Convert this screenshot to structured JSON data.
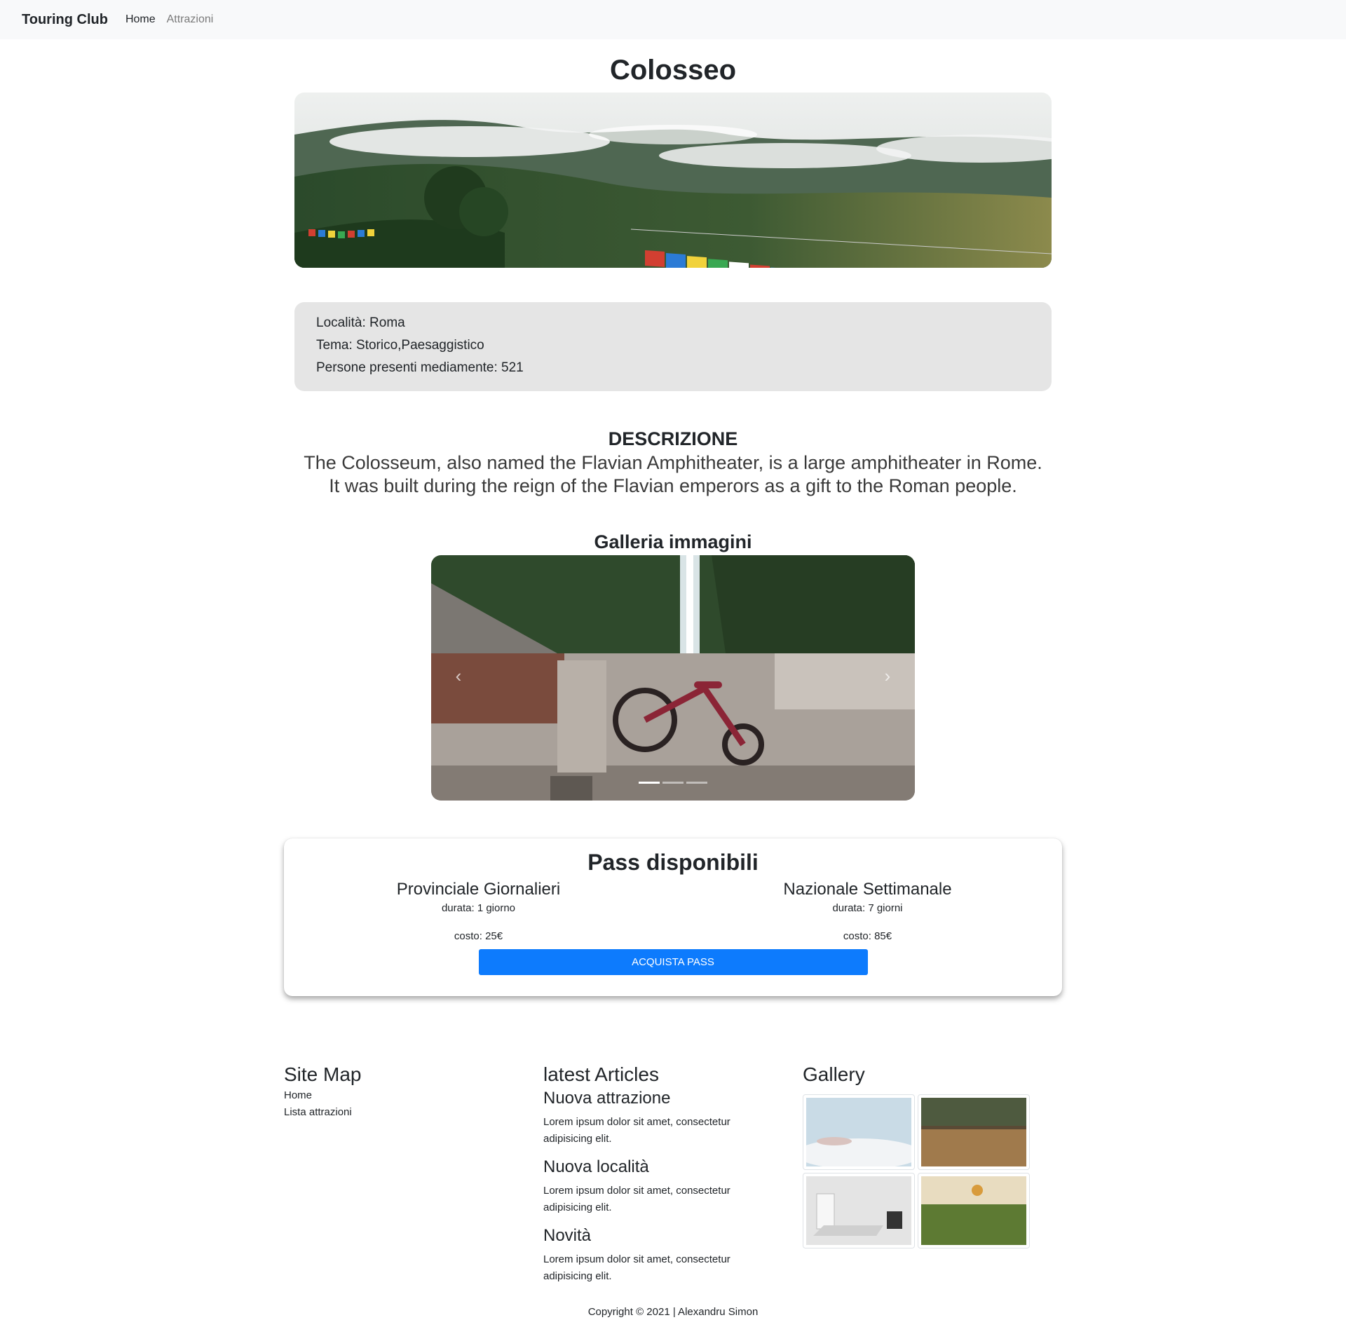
{
  "navbar": {
    "brand": "Touring Club",
    "links": [
      "Home",
      "Attrazioni"
    ]
  },
  "page": {
    "title": "Colosseo",
    "info": {
      "localita": "Località: Roma",
      "tema": "Tema: Storico,Paesaggistico",
      "persone": "Persone presenti mediamente: 521"
    },
    "description": {
      "heading": "DESCRIZIONE",
      "line1": "The Colosseum, also named the Flavian Amphitheater, is a large amphitheater in Rome.",
      "line2": "It was built during the reign of the Flavian emperors as a gift to the Roman people."
    }
  },
  "gallery": {
    "title": "Galleria immagini",
    "slides": 3,
    "active_slide": 1
  },
  "passes": {
    "title": "Pass disponibili",
    "items": [
      {
        "name": "Provinciale Giornalieri",
        "durata": "durata: 1 giorno",
        "costo": "costo: 25€"
      },
      {
        "name": "Nazionale Settimanale",
        "durata": "durata: 7 giorni",
        "costo": "costo: 85€"
      }
    ],
    "button_label": "ACQUISTA PASS"
  },
  "footer": {
    "sitemap": {
      "title": "Site Map",
      "links": [
        "Home",
        "Lista attrazioni"
      ]
    },
    "articles": {
      "title": "latest Articles",
      "items": [
        {
          "title": "Nuova attrazione",
          "text": "Lorem ipsum dolor sit amet, consectetur adipisicing elit."
        },
        {
          "title": "Nuova località",
          "text": "Lorem ipsum dolor sit amet, consectetur adipisicing elit."
        },
        {
          "title": "Novità",
          "text": "Lorem ipsum dolor sit amet, consectetur adipisicing elit."
        }
      ]
    },
    "gallery": {
      "title": "Gallery"
    },
    "copyright": "Copyright © 2021 | Alexandru Simon"
  },
  "colors": {
    "navbar_bg": "#f8f9fa",
    "info_bg": "#e5e5e5",
    "button_bg": "#0d7bfd"
  }
}
